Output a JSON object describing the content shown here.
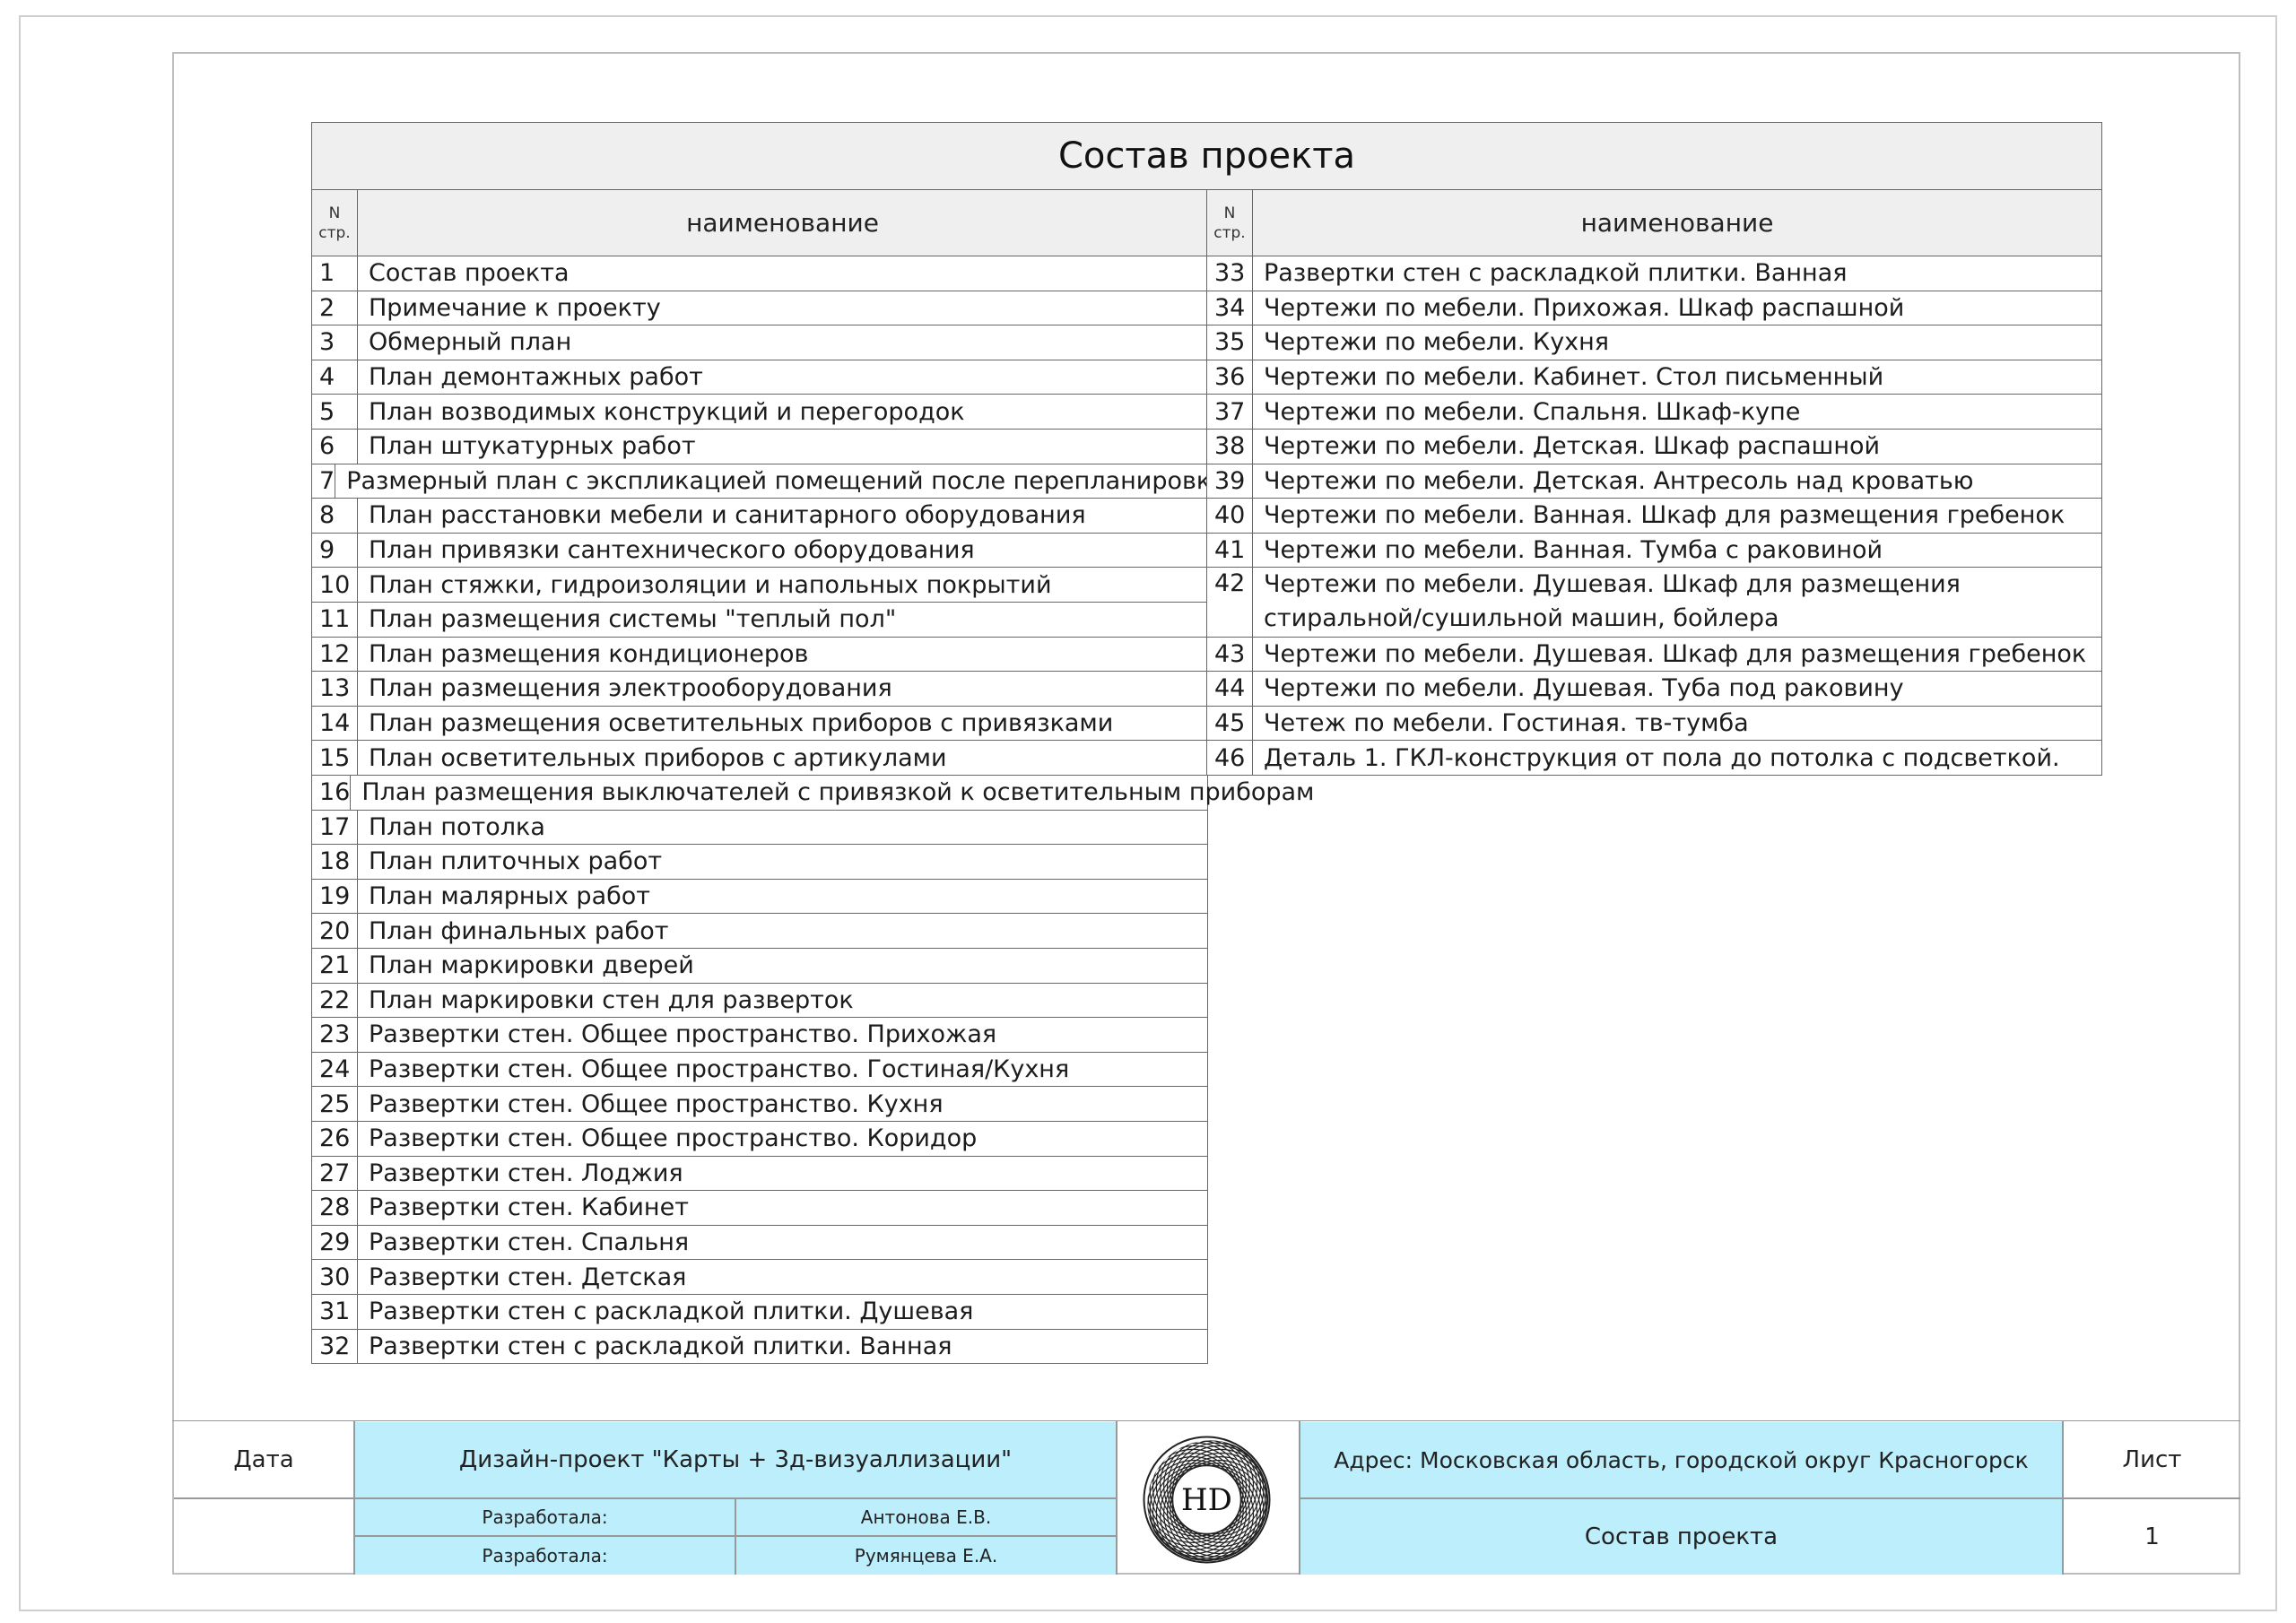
{
  "table": {
    "title": "Состав проекта",
    "header": {
      "num_top": "N",
      "num_bottom": "стр.",
      "name": "наименование"
    },
    "left_rows": [
      {
        "n": "1",
        "name": "Состав проекта"
      },
      {
        "n": "2",
        "name": "Примечание к проекту"
      },
      {
        "n": "3",
        "name": "Обмерный план"
      },
      {
        "n": "4",
        "name": "План демонтажных работ"
      },
      {
        "n": "5",
        "name": "План возводимых конструкций и перегородок"
      },
      {
        "n": "6",
        "name": "План штукатурных работ"
      },
      {
        "n": "7",
        "name": "Размерный план с экспликацией помещений после перепланировки"
      },
      {
        "n": "8",
        "name": "План расстановки мебели и санитарного оборудования"
      },
      {
        "n": "9",
        "name": "План привязки сантехнического оборудования"
      },
      {
        "n": "10",
        "name": "План стяжки, гидроизоляции и напольных покрытий"
      },
      {
        "n": "11",
        "name": "План размещения системы \"теплый пол\""
      },
      {
        "n": "12",
        "name": "План размещения кондиционеров"
      },
      {
        "n": "13",
        "name": "План размещения электрооборудования"
      },
      {
        "n": "14",
        "name": "План размещения осветительных приборов с привязками"
      },
      {
        "n": "15",
        "name": "План осветительных приборов с артикулами"
      },
      {
        "n": "16",
        "name": "План размещения выключателей с привязкой к осветительным приборам"
      },
      {
        "n": "17",
        "name": "План потолка"
      },
      {
        "n": "18",
        "name": "План плиточных работ"
      },
      {
        "n": "19",
        "name": "План малярных работ"
      },
      {
        "n": "20",
        "name": "План финальных работ"
      },
      {
        "n": "21",
        "name": "План маркировки дверей"
      },
      {
        "n": "22",
        "name": "План маркировки стен для разверток"
      },
      {
        "n": "23",
        "name": "Развертки стен. Общее пространство. Прихожая"
      },
      {
        "n": "24",
        "name": "Развертки стен. Общее пространство. Гостиная/Кухня"
      },
      {
        "n": "25",
        "name": "Развертки стен. Общее пространство. Кухня"
      },
      {
        "n": "26",
        "name": "Развертки стен. Общее пространство. Коридор"
      },
      {
        "n": "27",
        "name": "Развертки стен. Лоджия"
      },
      {
        "n": "28",
        "name": "Развертки стен. Кабинет"
      },
      {
        "n": "29",
        "name": "Развертки стен. Спальня"
      },
      {
        "n": "30",
        "name": "Развертки стен. Детская"
      },
      {
        "n": "31",
        "name": "Развертки стен с раскладкой плитки. Душевая"
      },
      {
        "n": "32",
        "name": "Развертки стен с раскладкой плитки. Ванная"
      }
    ],
    "right_rows": [
      {
        "n": "33",
        "name": "Развертки стен с раскладкой плитки. Ванная"
      },
      {
        "n": "34",
        "name": "Чертежи по мебели. Прихожая. Шкаф распашной"
      },
      {
        "n": "35",
        "name": "Чертежи по мебели. Кухня"
      },
      {
        "n": "36",
        "name": "Чертежи по мебели. Кабинет. Стол письменный"
      },
      {
        "n": "37",
        "name": "Чертежи по мебели. Спальня. Шкаф-купе"
      },
      {
        "n": "38",
        "name": "Чертежи по мебели. Детская. Шкаф распашной"
      },
      {
        "n": "39",
        "name": "Чертежи по мебели. Детская. Антресоль над кроватью"
      },
      {
        "n": "40",
        "name": "Чертежи по мебели. Ванная. Шкаф для размещения гребенок"
      },
      {
        "n": "41",
        "name": "Чертежи по мебели. Ванная. Тумба с раковиной"
      },
      {
        "n": "42",
        "name": "Чертежи по мебели. Душевая. Шкаф для размещения стиральной/сушильной машин, бойлера"
      },
      {
        "n": "43",
        "name": "Чертежи по мебели. Душевая. Шкаф для размещения гребенок"
      },
      {
        "n": "44",
        "name": "Чертежи по мебели. Душевая. Туба под раковину"
      },
      {
        "n": "45",
        "name": "Четеж по мебели. Гостиная. тв-тумба"
      },
      {
        "n": "46",
        "name": "Деталь 1. ГКЛ-конструкция от пола до потолка с подсветкой."
      }
    ]
  },
  "title_block": {
    "date_label": "Дата",
    "project_title": "Дизайн-проект \"Карты + 3д-визуаллизации\"",
    "developers": [
      {
        "role": "Разработала:",
        "name": "Антонова Е.В."
      },
      {
        "role": "Разработала:",
        "name": "Румянцева Е.А."
      }
    ],
    "logo_text": "HD",
    "address": "Адрес: Московская область, городской округ Красногорск",
    "sheet_name": "Состав проекта",
    "sheet_label": "Лист",
    "sheet_number": "1",
    "cyan_color": "#bdeefc"
  }
}
